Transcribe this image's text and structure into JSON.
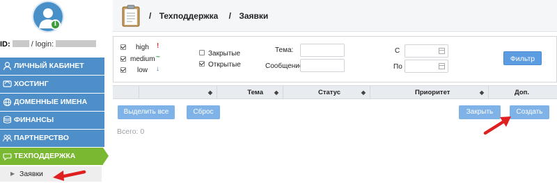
{
  "sidebar": {
    "id_label": "ID:",
    "login_label": "/ login:",
    "menu": [
      {
        "label": "Личный кабинет",
        "icon": "user-icon"
      },
      {
        "label": "Хостинг",
        "icon": "hosting-icon"
      },
      {
        "label": "Доменные имена",
        "icon": "globe-icon"
      },
      {
        "label": "Финансы",
        "icon": "coins-icon"
      },
      {
        "label": "Партнерство",
        "icon": "partners-icon"
      },
      {
        "label": "Техподдержка",
        "icon": "chat-bubble-icon",
        "active": true
      }
    ],
    "submenu": [
      {
        "label": "Заявки"
      }
    ]
  },
  "header": {
    "crumb_1": "Техподдержка",
    "crumb_2": "Заявки",
    "separator": "/"
  },
  "filters": {
    "priorities": [
      {
        "label": "high",
        "checked": true,
        "icon": "exclamation-icon",
        "glyph": "!",
        "color": "#d9342b"
      },
      {
        "label": "medium",
        "checked": true,
        "icon": "tilde-icon",
        "glyph": "~",
        "color": "#3aa35a"
      },
      {
        "label": "low",
        "checked": true,
        "icon": "down-arrow-icon",
        "glyph": "↓",
        "color": "#3b6fb6"
      }
    ],
    "status": [
      {
        "label": "Закрытые",
        "checked": false
      },
      {
        "label": "Открытые",
        "checked": true
      }
    ],
    "subject_label": "Тема:",
    "subject_value": "",
    "message_label": "Сообщение:",
    "message_value": "",
    "from_label": "С",
    "from_value": "",
    "to_label": "По",
    "to_value": "",
    "filter_button": "Фильтр"
  },
  "table": {
    "columns": [
      "",
      "",
      "Тема",
      "Статус",
      "Приоритет",
      "Доп."
    ],
    "total_text": "Всего: 0"
  },
  "actions": {
    "select_all": "Выделить все",
    "reset": "Сброс",
    "close": "Закрыть",
    "create": "Создать"
  },
  "colors": {
    "menu_blue": "#4f8fc9",
    "menu_active": "#7bb832",
    "button_blue": "#5c9ce0",
    "arrow_red": "#e02020"
  }
}
